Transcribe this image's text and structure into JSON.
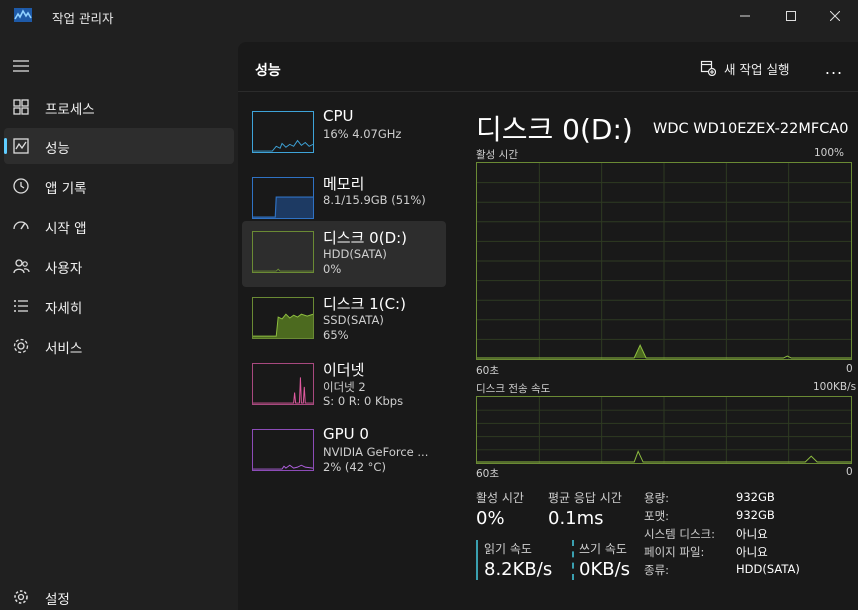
{
  "window": {
    "title": "작업 관리자",
    "controls": [
      "minimize",
      "maximize",
      "close"
    ]
  },
  "nav": {
    "items": [
      {
        "label": "프로세스",
        "icon": "processes-icon",
        "active": false
      },
      {
        "label": "성능",
        "icon": "performance-icon",
        "active": true
      },
      {
        "label": "앱 기록",
        "icon": "app-history-icon",
        "active": false
      },
      {
        "label": "시작 앱",
        "icon": "startup-apps-icon",
        "active": false
      },
      {
        "label": "사용자",
        "icon": "users-icon",
        "active": false
      },
      {
        "label": "자세히",
        "icon": "details-icon",
        "active": false
      },
      {
        "label": "서비스",
        "icon": "services-icon",
        "active": false
      }
    ],
    "settings_label": "설정"
  },
  "header": {
    "title": "성능",
    "new_task_label": "새 작업 실행",
    "more_label": "..."
  },
  "devices": [
    {
      "name": "CPU",
      "sub1": "16% 4.07GHz",
      "sub2": "",
      "color": "#3ea3d8",
      "active": false
    },
    {
      "name": "메모리",
      "sub1": "8.1/15.9GB (51%)",
      "sub2": "",
      "color": "#2f72c4",
      "active": false
    },
    {
      "name": "디스크 0(D:)",
      "sub1": "HDD(SATA)",
      "sub2": "0%",
      "color": "#6a8a34",
      "active": true
    },
    {
      "name": "디스크 1(C:)",
      "sub1": "SSD(SATA)",
      "sub2": "65%",
      "color": "#6a8a34",
      "active": false
    },
    {
      "name": "이더넷",
      "sub1": "이더넷 2",
      "sub2": "S: 0 R: 0 Kbps",
      "color": "#a8497f",
      "active": false
    },
    {
      "name": "GPU 0",
      "sub1": "NVIDIA GeForce ...",
      "sub2": "2% (42 °C)",
      "color": "#8c4cb8",
      "active": false
    }
  ],
  "detail": {
    "title": "디스크 0(D:)",
    "model": "WDC WD10EZEX-22MFCA0",
    "graph1": {
      "label": "활성 시간",
      "max": "100%",
      "left": "60초",
      "right": "0"
    },
    "graph2": {
      "label": "디스크 전송 속도",
      "max": "100KB/s",
      "left": "60초",
      "right": "0"
    },
    "stats": {
      "active_time_label": "활성 시간",
      "active_time_value": "0%",
      "avg_response_label": "평균 응답 시간",
      "avg_response_value": "0.1ms",
      "read_label": "읽기 속도",
      "read_value": "8.2KB/s",
      "write_label": "쓰기 속도",
      "write_value": "0KB/s"
    },
    "properties": [
      {
        "key": "용량:",
        "value": "932GB"
      },
      {
        "key": "포맷:",
        "value": "932GB"
      },
      {
        "key": "시스템 디스크:",
        "value": "아니요"
      },
      {
        "key": "페이지 파일:",
        "value": "아니요"
      },
      {
        "key": "종류:",
        "value": "HDD(SATA)"
      }
    ]
  },
  "colors": {
    "accent": "#60cdff",
    "disk_line": "#6a8a34",
    "disk_fill": "#4c6a1f",
    "read_marker": "#3aa0b0"
  }
}
